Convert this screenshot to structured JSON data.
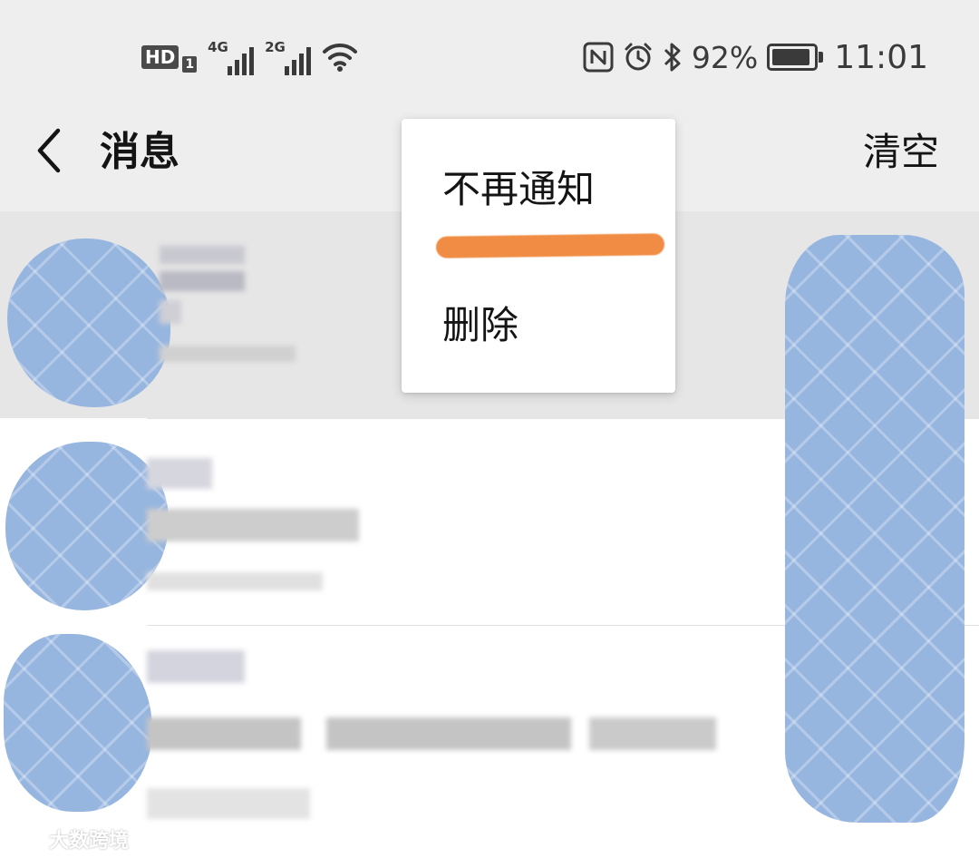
{
  "status_bar": {
    "hd": "HD",
    "sim": "1",
    "net1": "4G",
    "net2": "2G",
    "battery_percent": "92%",
    "battery_level": 0.92,
    "time": "11:01",
    "icons": [
      "nfc-icon",
      "alarm-icon",
      "bluetooth-icon",
      "wifi-icon",
      "battery-icon"
    ]
  },
  "header": {
    "back_icon": "chevron-left-icon",
    "title": "消息",
    "clear_label": "清空"
  },
  "popup": {
    "items": [
      {
        "label": "不再通知"
      },
      {
        "label": "删除"
      }
    ],
    "annotation_color": "#f08c43"
  },
  "watermark": {
    "text": "大数跨境"
  },
  "colors": {
    "redaction": "#97b6df",
    "header_bg": "#eeeeee",
    "selected_row_bg": "#e6e6e6"
  }
}
